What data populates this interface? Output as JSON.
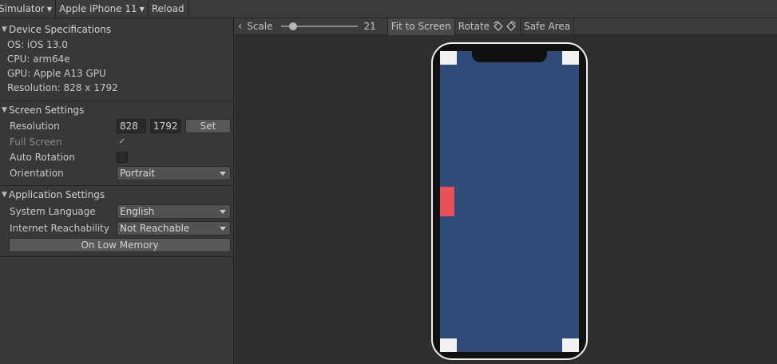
{
  "toolbar": {
    "simulator_label": "Simulator",
    "device_label": "Apple iPhone 11",
    "reload_label": "Reload"
  },
  "device_specs": {
    "header": "Device Specifications",
    "os": "OS: iOS 13.0",
    "cpu": "CPU: arm64e",
    "gpu": "GPU: Apple A13 GPU",
    "resolution": "Resolution: 828 x 1792"
  },
  "screen_settings": {
    "header": "Screen Settings",
    "resolution_label": "Resolution",
    "width_value": "828",
    "height_value": "1792",
    "set_button": "Set",
    "full_screen_label": "Full Screen",
    "full_screen_checked": true,
    "auto_rotation_label": "Auto Rotation",
    "auto_rotation_checked": false,
    "orientation_label": "Orientation",
    "orientation_value": "Portrait"
  },
  "app_settings": {
    "header": "Application Settings",
    "language_label": "System Language",
    "language_value": "English",
    "reachability_label": "Internet Reachability",
    "reachability_value": "Not Reachable",
    "low_memory_button": "On Low Memory"
  },
  "viewport_toolbar": {
    "scale_label": "Scale",
    "scale_value": "21",
    "scale_fraction": 0.16,
    "fit_label": "Fit to Screen",
    "rotate_label": "Rotate",
    "safe_area_label": "Safe Area"
  },
  "colors": {
    "screen_background": "#2f4c78",
    "red_element": "#e8515a",
    "phone_bezel": "#111111"
  }
}
